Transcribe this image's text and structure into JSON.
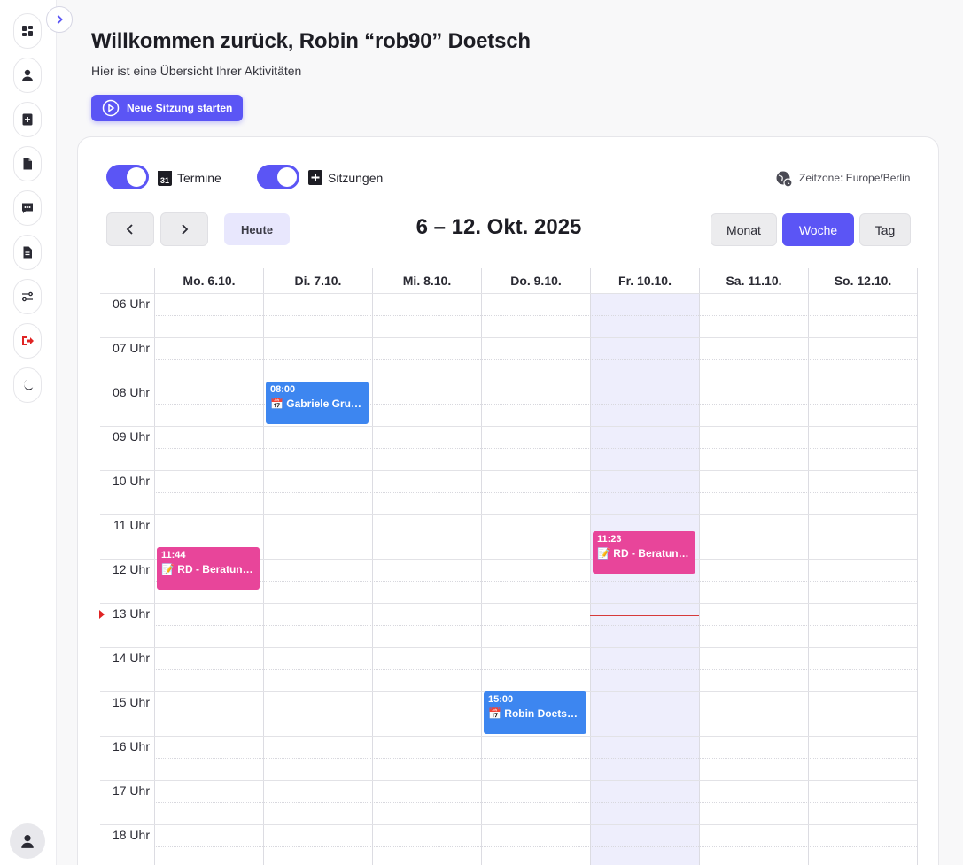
{
  "sidebar": {
    "items": [
      {
        "name": "dashboard-icon"
      },
      {
        "name": "user-icon"
      },
      {
        "name": "session-add-icon"
      },
      {
        "name": "document-icon"
      },
      {
        "name": "chat-icon"
      },
      {
        "name": "file-text-icon"
      },
      {
        "name": "settings-sliders-icon"
      },
      {
        "name": "logout-icon",
        "color": "#e02424"
      },
      {
        "name": "moon-icon"
      }
    ],
    "avatar_icon": "user-avatar-icon"
  },
  "header": {
    "title": "Willkommen zurück, Robin “rob90” Doetsch",
    "subtitle": "Hier ist eine Übersicht Ihrer Aktivitäten",
    "start_button": "Neue Sitzung starten"
  },
  "calendar": {
    "toggles": {
      "appointments_label": "Termine",
      "sessions_label": "Sitzungen",
      "appointments_on": true,
      "sessions_on": true
    },
    "timezone_label": "Zeitzone: Europe/Berlin",
    "today_button": "Heute",
    "range_title": "6 – 12. Okt. 2025",
    "views": [
      "Monat",
      "Woche",
      "Tag"
    ],
    "active_view": "Woche",
    "days": [
      "Mo. 6.10.",
      "Di. 7.10.",
      "Mi. 8.10.",
      "Do. 9.10.",
      "Fr. 10.10.",
      "Sa. 11.10.",
      "So. 12.10."
    ],
    "today_index": 4,
    "hours": [
      "06 Uhr",
      "07 Uhr",
      "08 Uhr",
      "09 Uhr",
      "10 Uhr",
      "11 Uhr",
      "12 Uhr",
      "13 Uhr",
      "14 Uhr",
      "15 Uhr",
      "16 Uhr",
      "17 Uhr",
      "18 Uhr"
    ],
    "events": [
      {
        "day": 1,
        "time": "08:00",
        "title": "📅 Gabriele Gru…",
        "kind": "appointment",
        "color": "#3d86f0"
      },
      {
        "day": 0,
        "time": "11:44",
        "title": "📝 RD - Beratun…",
        "kind": "session",
        "color": "#e8459a"
      },
      {
        "day": 4,
        "time": "11:23",
        "title": "📝 RD - Beratun…",
        "kind": "session",
        "color": "#e8459a"
      },
      {
        "day": 3,
        "time": "15:00",
        "title": "📅 Robin Doetsc…",
        "kind": "appointment",
        "color": "#3d86f0"
      }
    ]
  },
  "colors": {
    "accent": "#5b55f5",
    "appointment": "#3d86f0",
    "session": "#e8459a",
    "now_indicator": "#e02424"
  }
}
